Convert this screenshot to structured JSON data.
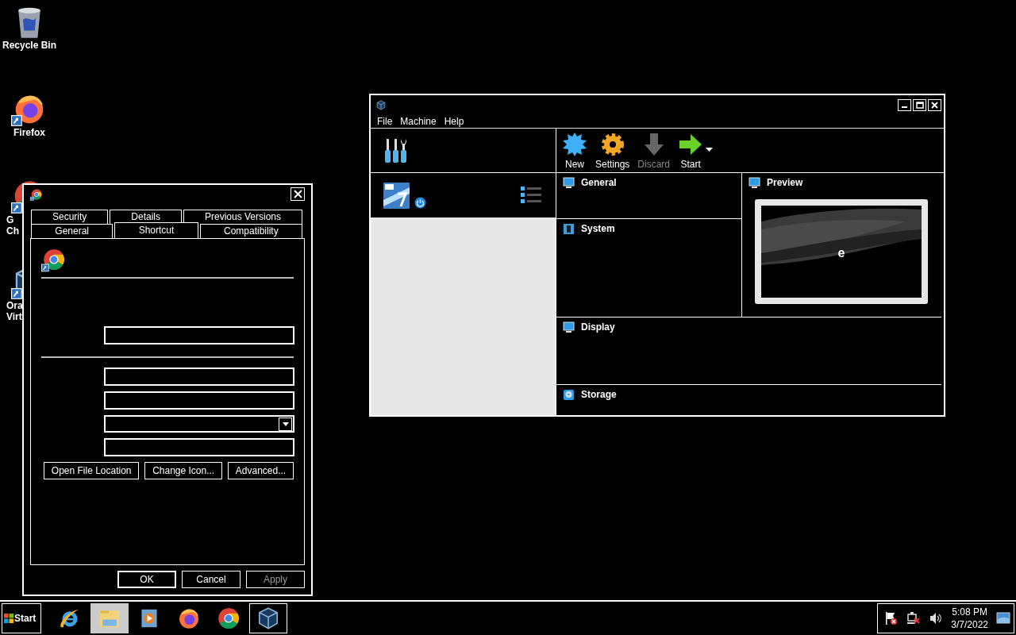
{
  "desktop_icons": [
    {
      "kind": "recycle-bin",
      "label_lines": [
        "Recycle Bin"
      ]
    },
    {
      "kind": "firefox",
      "label_lines": [
        "Firefox"
      ]
    },
    {
      "kind": "chrome",
      "label_lines": [
        "G",
        "Ch"
      ]
    },
    {
      "kind": "virtualbox",
      "label_lines": [
        "Ora",
        "Virt"
      ]
    }
  ],
  "properties_dialog": {
    "tab_rows": [
      [
        {
          "label": "Security",
          "selected": false
        },
        {
          "label": "Details",
          "selected": false
        },
        {
          "label": "Previous Versions",
          "selected": false
        }
      ],
      [
        {
          "label": "General",
          "selected": false
        },
        {
          "label": "Shortcut",
          "selected": true
        },
        {
          "label": "Compatibility",
          "selected": false
        }
      ]
    ],
    "fields": [
      {
        "kind": "text"
      },
      {
        "kind": "separator"
      },
      {
        "kind": "text"
      },
      {
        "kind": "text"
      },
      {
        "kind": "dropdown"
      },
      {
        "kind": "text"
      }
    ],
    "buttons": [
      {
        "label": "Open File Location"
      },
      {
        "label": "Change Icon..."
      },
      {
        "label": "Advanced..."
      }
    ],
    "footer_buttons": [
      {
        "label": "OK",
        "default": true,
        "disabled": false
      },
      {
        "label": "Cancel",
        "default": false,
        "disabled": false
      },
      {
        "label": "Apply",
        "default": false,
        "disabled": true
      }
    ]
  },
  "virtualbox_window": {
    "menu": [
      "File",
      "Machine",
      "Help"
    ],
    "toolbar": [
      {
        "kind": "new",
        "label": "New",
        "disabled": false
      },
      {
        "kind": "settings",
        "label": "Settings",
        "disabled": false
      },
      {
        "kind": "discard",
        "label": "Discard",
        "disabled": true
      },
      {
        "kind": "start",
        "label": "Start",
        "disabled": false
      }
    ],
    "sections": [
      {
        "kind": "monitor",
        "title": "General"
      },
      {
        "kind": "preview",
        "title": "Preview",
        "screen_text": "e"
      },
      {
        "kind": "chip",
        "title": "System"
      },
      {
        "kind": "monitor",
        "title": "Display"
      },
      {
        "kind": "disk",
        "title": "Storage"
      }
    ]
  },
  "taskbar": {
    "start": "Start",
    "items": [
      {
        "kind": "ie",
        "hovered": false,
        "selected": false
      },
      {
        "kind": "explorer",
        "hovered": true,
        "selected": false
      },
      {
        "kind": "media",
        "hovered": false,
        "selected": false
      },
      {
        "kind": "firefox",
        "hovered": false,
        "selected": false
      },
      {
        "kind": "chrome",
        "hovered": false,
        "selected": false
      },
      {
        "kind": "virtualbox",
        "hovered": false,
        "selected": true
      }
    ],
    "clock": {
      "time": "5:08 PM",
      "date": "3/7/2022"
    }
  }
}
